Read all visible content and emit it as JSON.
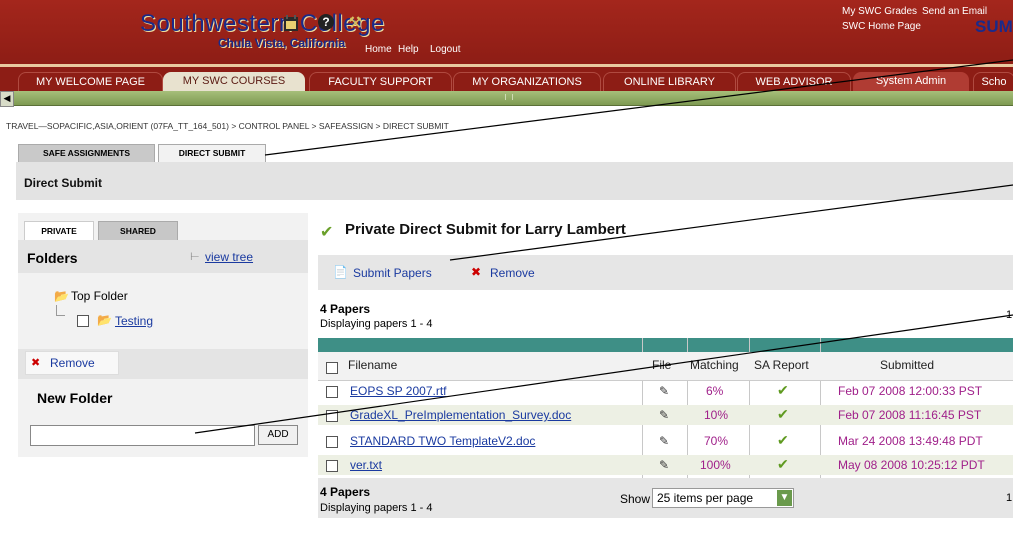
{
  "header": {
    "title": "Southwestern College",
    "subtitle": "Chula Vista, California",
    "links": [
      "Home",
      "Help",
      "Logout"
    ],
    "top_right_links": [
      "My SWC Grades",
      "Send an Email",
      "SWC Home Page"
    ],
    "top_right_brand": "SUM",
    "help_symbol": "?"
  },
  "tabs": [
    {
      "label": "MY WELCOME PAGE",
      "active": false
    },
    {
      "label": "MY SWC COURSES",
      "active": true
    },
    {
      "label": "FACULTY SUPPORT",
      "active": false
    },
    {
      "label": "MY ORGANIZATIONS",
      "active": false
    },
    {
      "label": "ONLINE LIBRARY",
      "active": false
    },
    {
      "label": "WEB ADVISOR",
      "active": false
    },
    {
      "label": "System Admin",
      "active": false
    },
    {
      "label": "Scho",
      "active": false
    }
  ],
  "breadcrumb": "TRAVEL—SOPACIFIC,ASIA,ORIENT (07FA_TT_164_501) > CONTROL PANEL > SAFEASSIGN > DIRECT SUBMIT",
  "subtabs": [
    "SAFE ASSIGNMENTS",
    "DIRECT SUBMIT"
  ],
  "page_title": "Direct Submit",
  "left": {
    "tabs": [
      "PRIVATE",
      "SHARED"
    ],
    "folders_label": "Folders",
    "view_tree": "view tree",
    "top_folder": "Top Folder",
    "subfolder": "Testing",
    "remove_label": "Remove",
    "new_folder_label": "New Folder",
    "new_folder_value": "",
    "add_label": "ADD"
  },
  "right": {
    "title": "Private Direct Submit for Larry Lambert",
    "actions": [
      "Submit Papers",
      "Remove"
    ],
    "count_label": "4 Papers",
    "displaying": "Displaying papers 1 - 4",
    "page_number": "1",
    "columns": [
      "Filename",
      "File",
      "Matching",
      "SA Report",
      "Submitted"
    ],
    "rows": [
      {
        "filename": "EOPS SP 2007.rtf",
        "matching": "6%",
        "submitted": "Feb 07 2008 12:00:33 PST"
      },
      {
        "filename": "GradeXL_PreImplementation_Survey.doc",
        "matching": "10%",
        "submitted": "Feb 07 2008 11:16:45 PST"
      },
      {
        "filename": "STANDARD TWO TemplateV2.doc",
        "matching": "70%",
        "submitted": "Mar 24 2008 13:49:48 PDT"
      },
      {
        "filename": "ver.txt",
        "matching": "100%",
        "submitted": "May 08 2008 10:25:12 PDT"
      }
    ],
    "show_label": "Show",
    "per_page": "25 items per page"
  },
  "colors": {
    "header_red": "#8d1d15",
    "scroll_green": "#7e9a52",
    "table_teal": "#3e8f86",
    "link_blue": "#1a3aa0",
    "value_purple": "#a0208a"
  }
}
